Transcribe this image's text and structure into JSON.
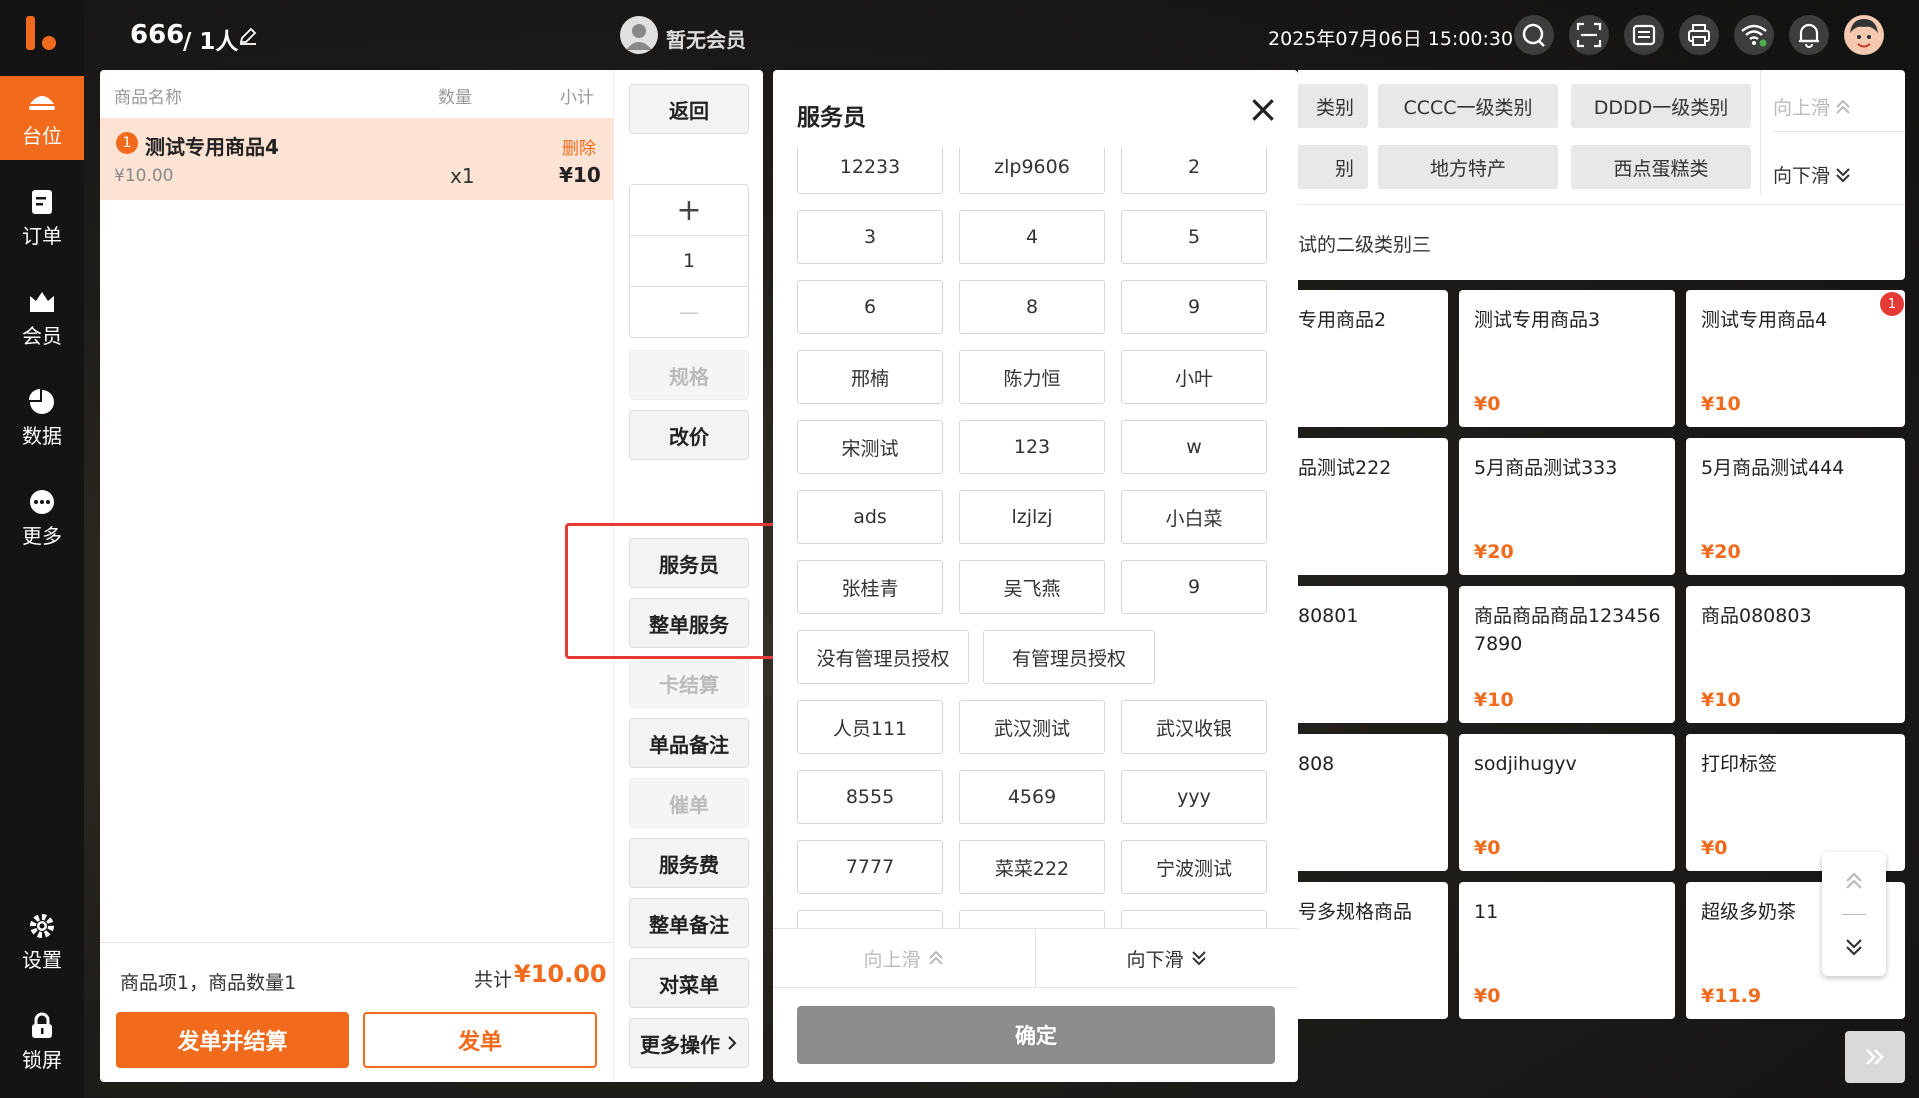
{
  "topbar": {
    "table_label": "666",
    "people_label": "/ 1人",
    "member_label": "暂无会员",
    "datetime": "2025年07月06日 15:00:30"
  },
  "sidebar": {
    "items": [
      {
        "label": "台位",
        "icon": "table-icon"
      },
      {
        "label": "订单",
        "icon": "order-icon"
      },
      {
        "label": "会员",
        "icon": "member-icon"
      },
      {
        "label": "数据",
        "icon": "chart-icon"
      },
      {
        "label": "更多",
        "icon": "more-icon"
      }
    ],
    "settings_label": "设置",
    "lock_label": "锁屏"
  },
  "order": {
    "col_name": "商品名称",
    "col_qty": "数量",
    "col_subtotal": "小计",
    "items": [
      {
        "index": "1",
        "name": "测试专用商品4",
        "unit_price": "¥10.00",
        "qty": "x1",
        "subtotal": "¥10",
        "delete_label": "删除"
      }
    ],
    "summary": "商品项1，商品数量1",
    "total_prefix": "共计",
    "total": "¥10.00",
    "btn_send_pay": "发单并结算",
    "btn_send": "发单"
  },
  "actions": {
    "back": "返回",
    "plus": "+",
    "qty": "1",
    "minus": "—",
    "spec": "规格",
    "change_price": "改价",
    "waiter": "服务员",
    "whole_service": "整单服务",
    "card_settle": "卡结算",
    "item_note": "单品备注",
    "rush": "催单",
    "service_fee": "服务费",
    "whole_note": "整单备注",
    "check_order": "对菜单",
    "more_ops": "更多操作"
  },
  "modal": {
    "title": "服务员",
    "close": "×",
    "waiters": [
      "12233",
      "zlp9606",
      "2",
      "3",
      "4",
      "5",
      "6",
      "8",
      "9",
      "邢楠",
      "陈力恒",
      "小叶",
      "宋测试",
      "123",
      "w",
      "ads",
      "lzjlzj",
      "小白菜",
      "张桂青",
      "吴飞燕",
      "9",
      "没有管理员授权",
      "有管理员授权",
      "人员111",
      "武汉测试",
      "武汉收银",
      "8555",
      "4569",
      "yyy",
      "7777",
      "菜菜222",
      "宁波测试"
    ],
    "scroll_up": "向上滑",
    "scroll_down": "向下滑",
    "confirm": "确定"
  },
  "categories": {
    "row1": [
      "类别",
      "CCCC一级类别",
      "DDDD一级类别"
    ],
    "row2": [
      "别",
      "地方特产",
      "西点蛋糕类"
    ],
    "scroll_up": "向上滑",
    "scroll_down": "向下滑",
    "sub": "试的二级类别三"
  },
  "goods": [
    {
      "name": "专用商品2",
      "price": ""
    },
    {
      "name": "测试专用商品3",
      "price": "¥0"
    },
    {
      "name": "测试专用商品4",
      "price": "¥10",
      "badge": "1"
    },
    {
      "name": "品测试222",
      "price": ""
    },
    {
      "name": "5月商品测试333",
      "price": "¥20"
    },
    {
      "name": "5月商品测试444",
      "price": "¥20"
    },
    {
      "name": "80801",
      "price": ""
    },
    {
      "name": "商品商品商品1234567890",
      "price": "¥10"
    },
    {
      "name": "商品080803",
      "price": "¥10"
    },
    {
      "name": "808",
      "price": ""
    },
    {
      "name": "sodjihugyv",
      "price": "¥0"
    },
    {
      "name": "打印标签",
      "price": "¥0"
    },
    {
      "name": "号多规格商品",
      "price": ""
    },
    {
      "name": "11",
      "price": "¥0"
    },
    {
      "name": "超级多奶茶",
      "price": "¥11.9"
    }
  ],
  "colors": {
    "accent": "#f26b1d",
    "highlight_box": "#e53935"
  }
}
